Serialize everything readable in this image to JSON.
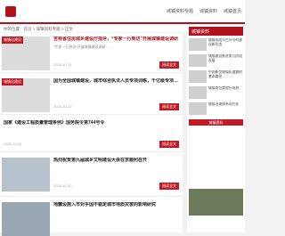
{
  "header": {
    "logo_text": "",
    "nav": [
      "城镇资料专题",
      "城镇资料",
      "城镇首页"
    ]
  },
  "breadcrumb": "你的位置：首页 > 城镇资料专题 > 正文",
  "articles": [
    {
      "tag": "城镇化建设",
      "title": "吉林省住房城乡建设厅指导，“专家一行到访”开展城镇建设调研",
      "desc": "“专家一行到访”开展城镇建设调研……",
      "date": "2025-10-24",
      "more": "阅读全文"
    },
    {
      "tag": "城镇化建设",
      "title": "国为全国城镇建设，城市综合执法人员专项训练，千亿级专项资金补充",
      "desc": "",
      "date": "2025-10-22",
      "more": "阅读全文"
    },
    {
      "tag": "",
      "title": "国家《建设工程质量管理条例》国务院令第744号令",
      "desc": "",
      "date": "2025-10-21",
      "more": "阅读全文"
    },
    {
      "tag": "",
      "title": "热烈祝贺第九届城乡文明建设大会在京顺利召开",
      "desc": "",
      "date": "2025-10-20",
      "more": "阅读全文"
    },
    {
      "tag": "",
      "title": "地震设施入市对乎国不稳定城市地质灾害的影响研究",
      "desc": "",
      "date": "",
      "more": ""
    }
  ],
  "sidebar": {
    "head": "城镇资料",
    "items": [
      "城镇化成为百分号的建设新形态",
      "城镇建设推进第九阶段发展",
      "中国新型城镇化道路的基本路径",
      "城镇首位度提升规划",
      "城镇治理体系现代化"
    ],
    "button": "城镇资料"
  }
}
